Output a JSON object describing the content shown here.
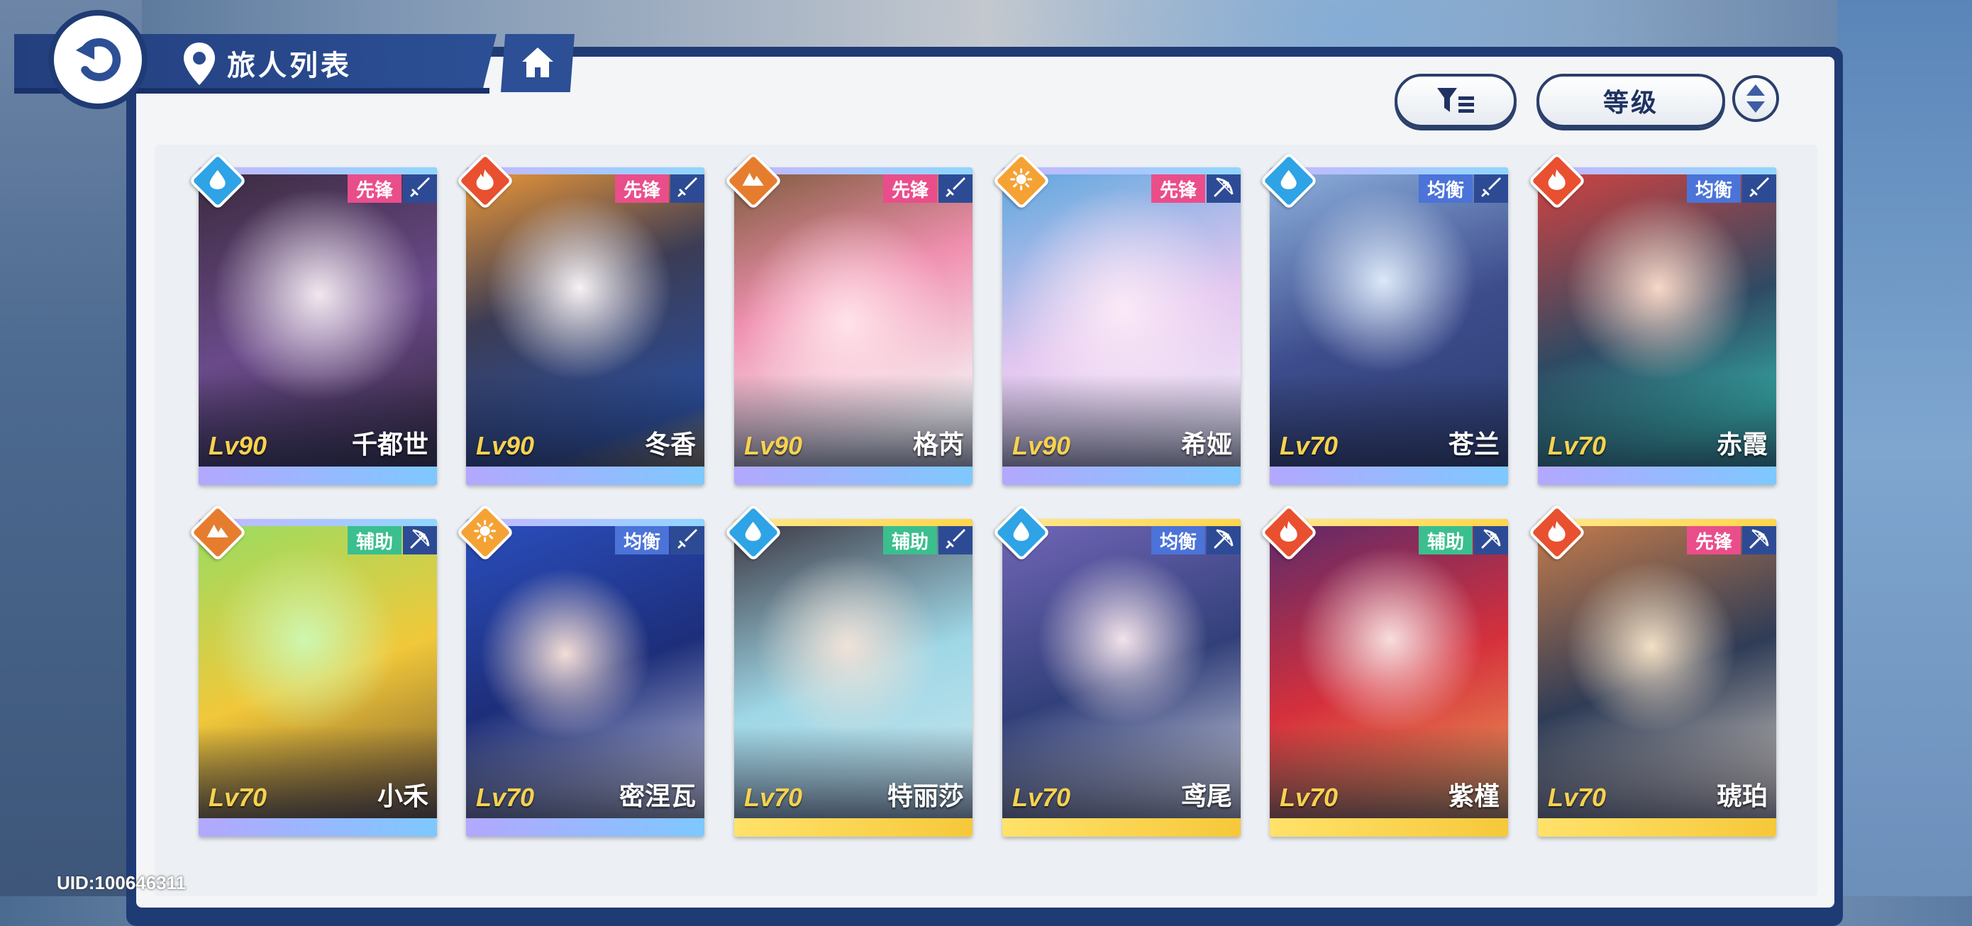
{
  "header": {
    "title": "旅人列表",
    "back_icon": "back-arrow-icon",
    "location_icon": "map-pin-icon",
    "home_icon": "home-icon"
  },
  "toolbar": {
    "filter_icon": "filter-icon",
    "sort_label": "等级",
    "order_icon": "sort-order-icon"
  },
  "uid": "UID:100646311",
  "colors": {
    "panel_navy": "#1f3b74",
    "role_pink": "#e94e8b",
    "role_blue": "#4b73d8",
    "role_green": "#3bbf8e",
    "level_gold": "#f6d24f"
  },
  "cards": [
    {
      "name": "千都世",
      "level": "Lv90",
      "role": "先锋",
      "element": "water",
      "weapon": "sword-icon"
    },
    {
      "name": "冬香",
      "level": "Lv90",
      "role": "先锋",
      "element": "fire",
      "weapon": "sword-icon"
    },
    {
      "name": "格芮",
      "level": "Lv90",
      "role": "先锋",
      "element": "earth",
      "weapon": "sword-icon"
    },
    {
      "name": "希娅",
      "level": "Lv90",
      "role": "先锋",
      "element": "light",
      "weapon": "bow-icon"
    },
    {
      "name": "苍兰",
      "level": "Lv70",
      "role": "均衡",
      "element": "water",
      "weapon": "sword-icon"
    },
    {
      "name": "赤霞",
      "level": "Lv70",
      "role": "均衡",
      "element": "fire",
      "weapon": "sword-icon"
    },
    {
      "name": "小禾",
      "level": "Lv70",
      "role": "辅助",
      "element": "earth",
      "weapon": "bow-icon"
    },
    {
      "name": "密涅瓦",
      "level": "Lv70",
      "role": "均衡",
      "element": "light",
      "weapon": "sword-icon"
    },
    {
      "name": "特丽莎",
      "level": "Lv70",
      "role": "辅助",
      "element": "water",
      "weapon": "sword-icon"
    },
    {
      "name": "鸢尾",
      "level": "Lv70",
      "role": "均衡",
      "element": "water",
      "weapon": "bow-icon"
    },
    {
      "name": "紫槿",
      "level": "Lv70",
      "role": "辅助",
      "element": "fire",
      "weapon": "bow-icon"
    },
    {
      "name": "琥珀",
      "level": "Lv70",
      "role": "先锋",
      "element": "fire",
      "weapon": "bow-icon"
    }
  ]
}
